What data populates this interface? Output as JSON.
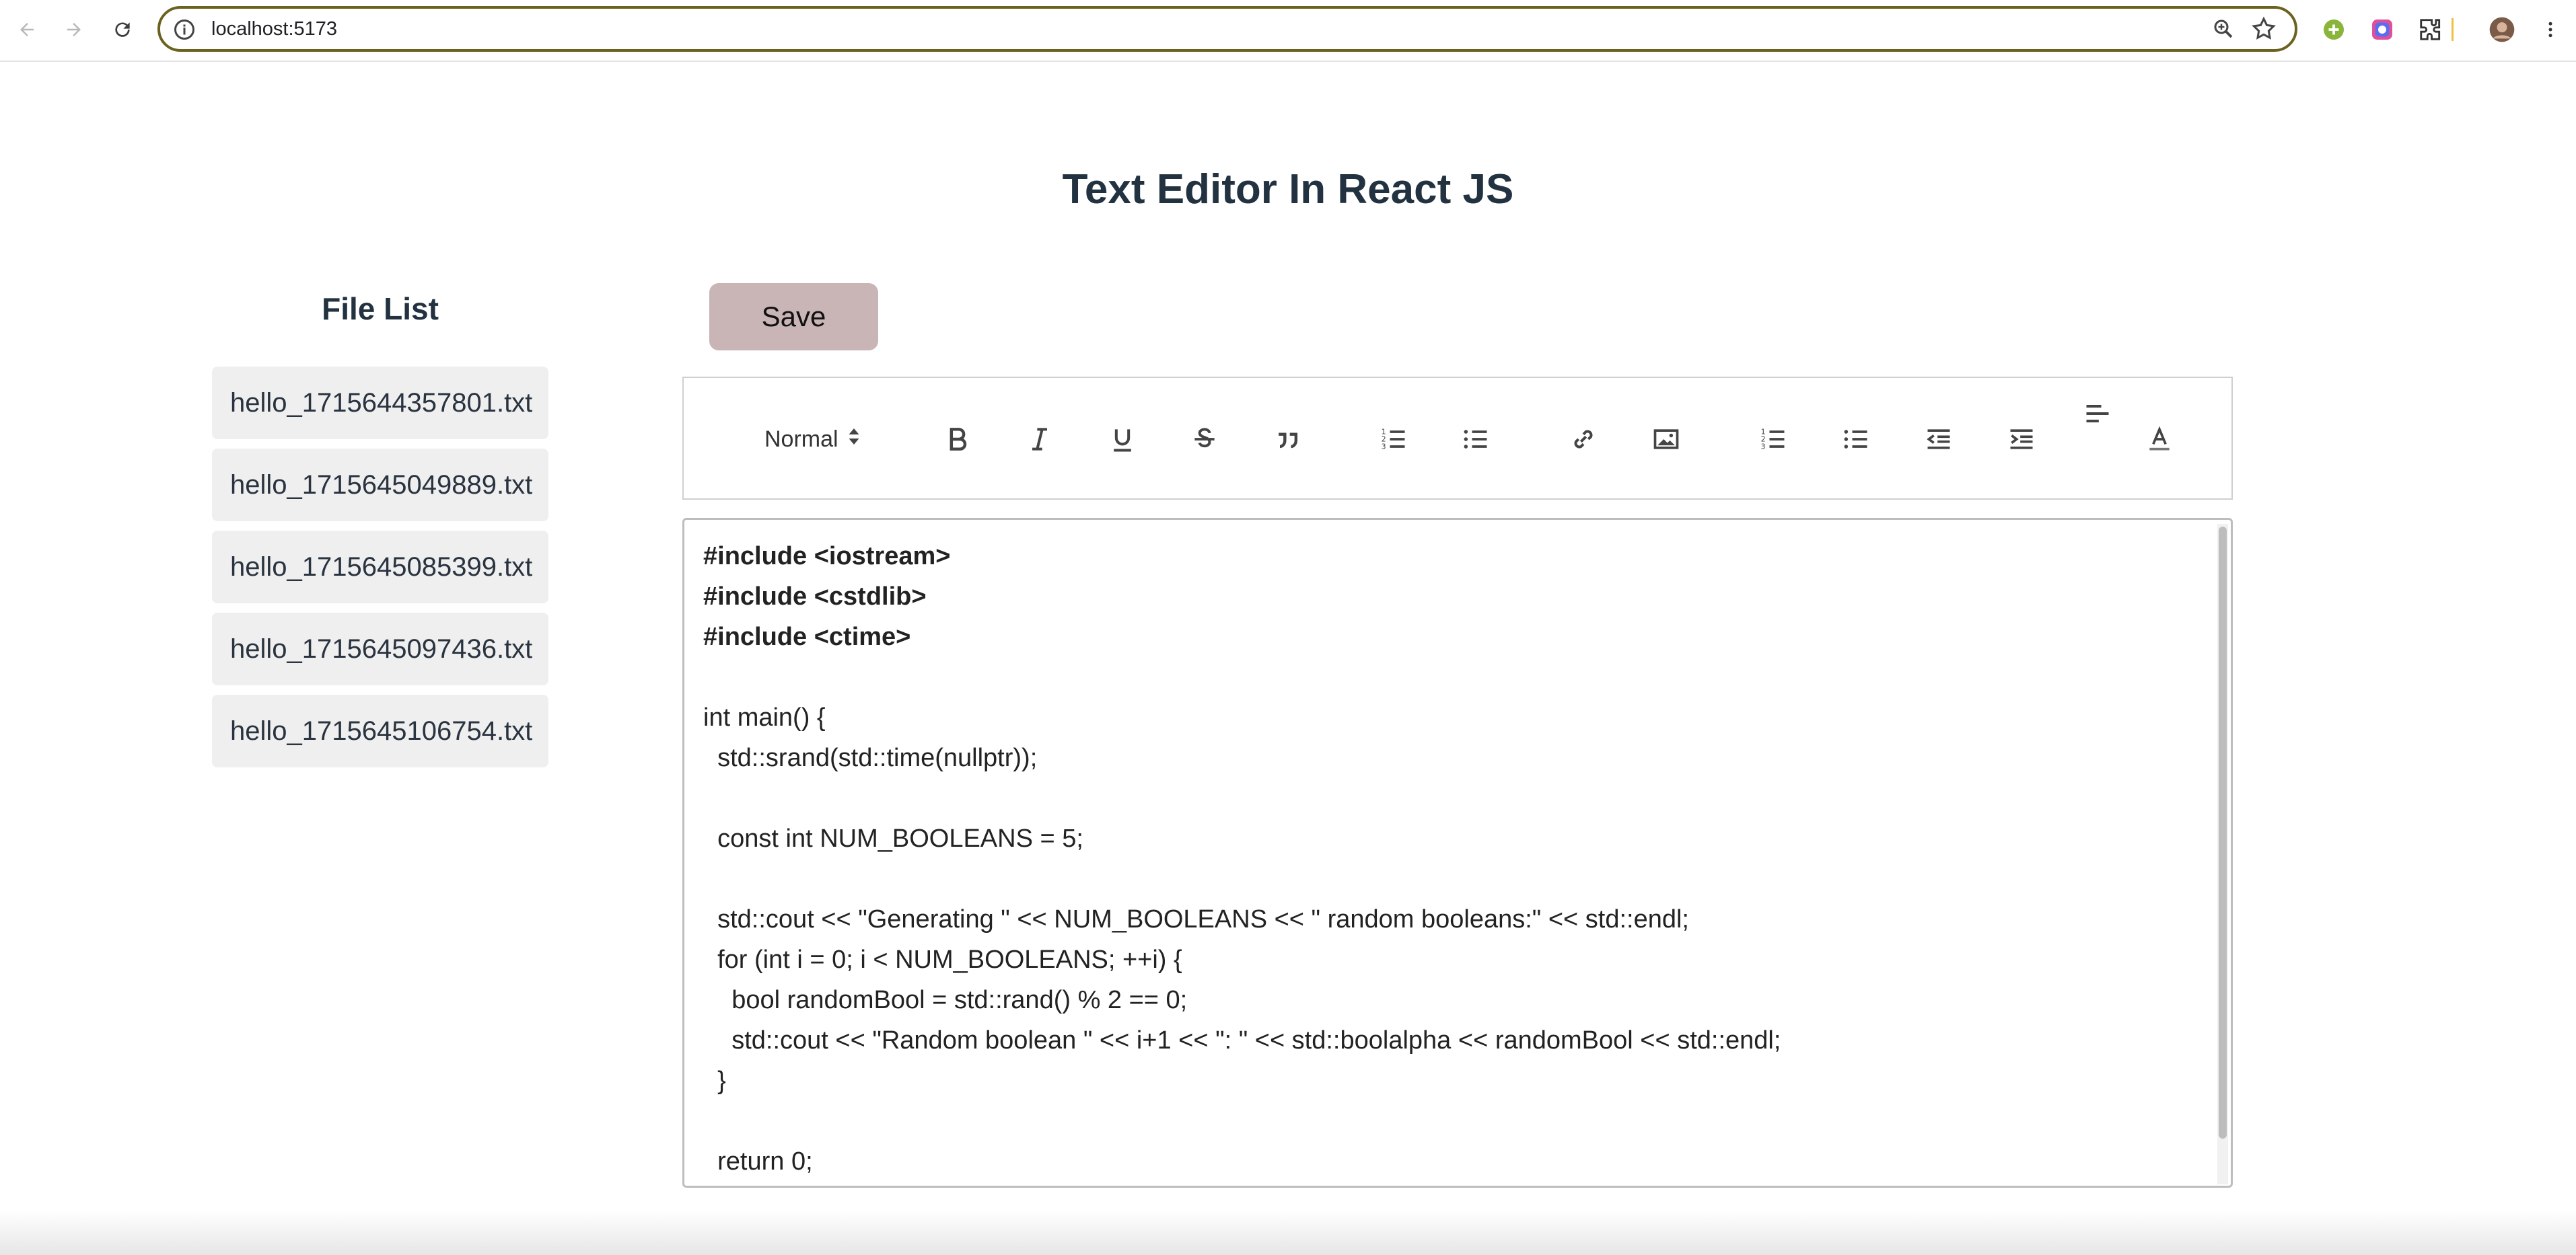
{
  "browser": {
    "url": "localhost:5173",
    "icons": [
      "back-icon",
      "forward-icon",
      "reload-icon",
      "site-info-icon",
      "zoom-icon",
      "bookmark-star-icon",
      "extension-icon",
      "profile-avatar",
      "menu-icon"
    ]
  },
  "page": {
    "title": "Text Editor In React JS"
  },
  "file_list": {
    "title": "File List",
    "files": [
      "hello_1715644357801.txt",
      "hello_1715645049889.txt",
      "hello_1715645085399.txt",
      "hello_1715645097436.txt",
      "hello_1715645106754.txt"
    ]
  },
  "editor": {
    "save_label": "Save",
    "header_select": "Normal",
    "toolbar_icons": [
      "bold-icon",
      "italic-icon",
      "underline-icon",
      "strike-icon",
      "blockquote-icon",
      "ordered-list-icon",
      "bullet-list-icon",
      "link-icon",
      "image-icon",
      "ordered-list-icon",
      "bullet-list-icon",
      "outdent-icon",
      "indent-icon",
      "align-icon",
      "text-color-icon"
    ],
    "lines": [
      "#include <iostream>",
      "#include <cstdlib>",
      "#include <ctime>",
      "",
      "int main() {",
      "  std::srand(std::time(nullptr));",
      "",
      "  const int NUM_BOOLEANS = 5;",
      "",
      "  std::cout << \"Generating \" << NUM_BOOLEANS << \" random booleans:\" << std::endl;",
      "  for (int i = 0; i < NUM_BOOLEANS; ++i) {",
      "    bool randomBool = std::rand() % 2 == 0;",
      "    std::cout << \"Random boolean \" << i+1 << \": \" << std::boolalpha << randomBool << std::endl;",
      "  }",
      "",
      "  return 0;"
    ]
  },
  "colors": {
    "save_button": "#c9b4b6",
    "url_border": "#6b6220",
    "title_text": "#223240",
    "file_item_bg": "#efefef"
  }
}
